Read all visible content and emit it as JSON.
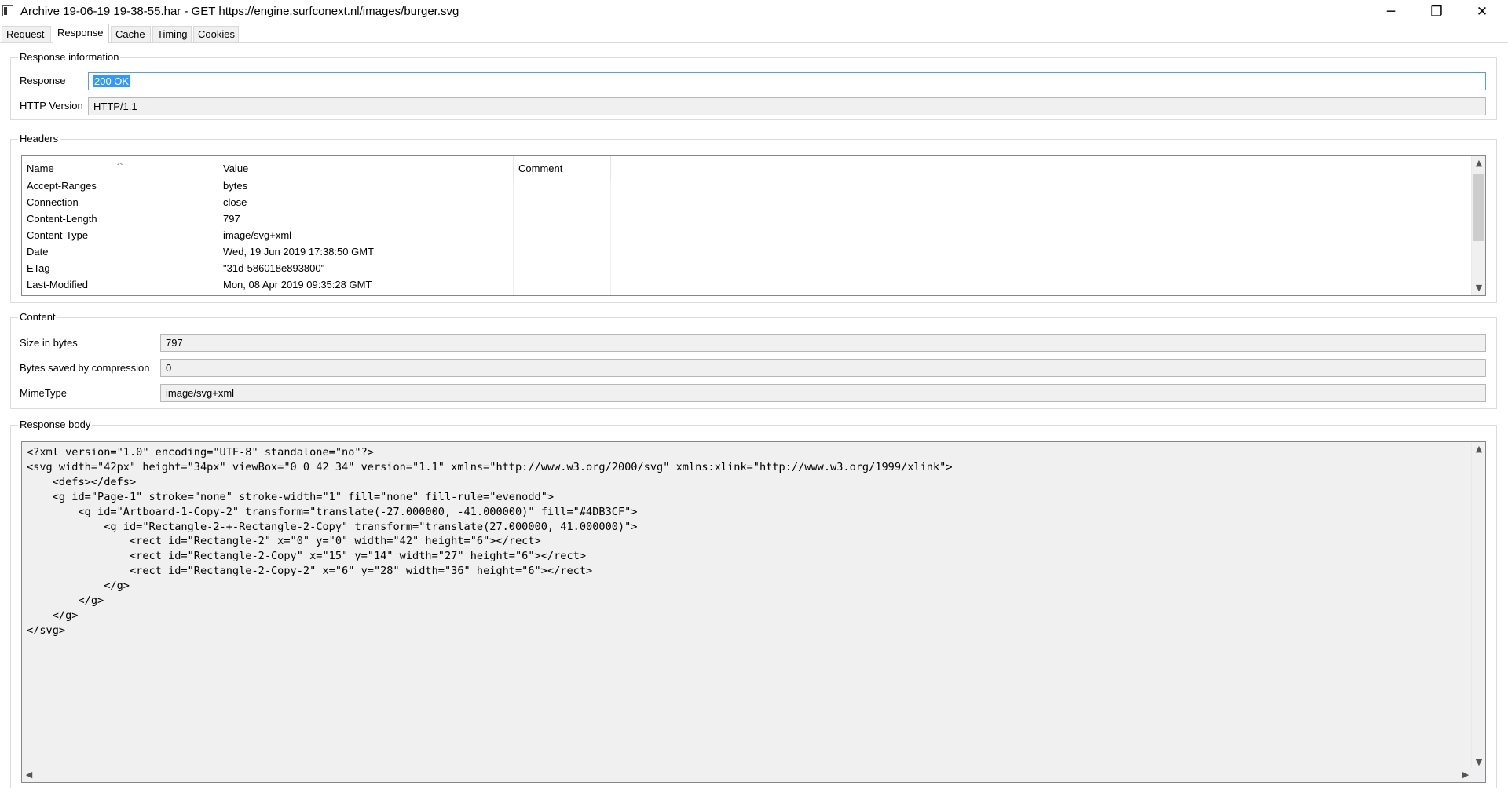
{
  "window": {
    "title": "Archive 19-06-19 19-38-55.har - GET https://engine.surfconext.nl/images/burger.svg",
    "minimize_glyph": "─",
    "maximize_glyph": "❐",
    "close_glyph": "✕"
  },
  "tabs": [
    {
      "label": "Request"
    },
    {
      "label": "Response",
      "active": true
    },
    {
      "label": "Cache"
    },
    {
      "label": "Timing"
    },
    {
      "label": "Cookies"
    }
  ],
  "response_info": {
    "title": "Response information",
    "response_label": "Response",
    "response_value": "200 OK",
    "http_version_label": "HTTP Version",
    "http_version_value": "HTTP/1.1"
  },
  "headers": {
    "title": "Headers",
    "columns": [
      "Name",
      "Value",
      "Comment"
    ],
    "rows": [
      {
        "name": "Accept-Ranges",
        "value": "bytes"
      },
      {
        "name": "Connection",
        "value": "close"
      },
      {
        "name": "Content-Length",
        "value": "797"
      },
      {
        "name": "Content-Type",
        "value": "image/svg+xml"
      },
      {
        "name": "Date",
        "value": "Wed, 19 Jun 2019 17:38:50 GMT"
      },
      {
        "name": "ETag",
        "value": "\"31d-586018e893800\""
      },
      {
        "name": "Last-Modified",
        "value": "Mon, 08 Apr 2019 09:35:28 GMT"
      }
    ]
  },
  "content": {
    "title": "Content",
    "size_label": "Size in bytes",
    "size_value": "797",
    "saved_label": "Bytes saved by compression",
    "saved_value": "0",
    "mime_label": "MimeType",
    "mime_value": "image/svg+xml"
  },
  "body": {
    "title": "Response body",
    "text": "<?xml version=\"1.0\" encoding=\"UTF-8\" standalone=\"no\"?>\n<svg width=\"42px\" height=\"34px\" viewBox=\"0 0 42 34\" version=\"1.1\" xmlns=\"http://www.w3.org/2000/svg\" xmlns:xlink=\"http://www.w3.org/1999/xlink\">\n    <defs></defs>\n    <g id=\"Page-1\" stroke=\"none\" stroke-width=\"1\" fill=\"none\" fill-rule=\"evenodd\">\n        <g id=\"Artboard-1-Copy-2\" transform=\"translate(-27.000000, -41.000000)\" fill=\"#4DB3CF\">\n            <g id=\"Rectangle-2-+-Rectangle-2-Copy\" transform=\"translate(27.000000, 41.000000)\">\n                <rect id=\"Rectangle-2\" x=\"0\" y=\"0\" width=\"42\" height=\"6\"></rect>\n                <rect id=\"Rectangle-2-Copy\" x=\"15\" y=\"14\" width=\"27\" height=\"6\"></rect>\n                <rect id=\"Rectangle-2-Copy-2\" x=\"6\" y=\"28\" width=\"36\" height=\"6\"></rect>\n            </g>\n        </g>\n    </g>\n</svg>"
  }
}
